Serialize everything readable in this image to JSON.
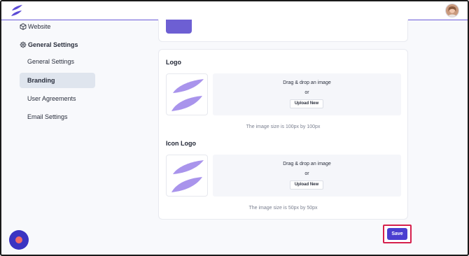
{
  "colors": {
    "accent": "#4a3ed0",
    "logo_purple": "#7b62e0",
    "logo_light": "#b7a8ee",
    "highlight_border": "#d6204d"
  },
  "header": {
    "brand_icon": "leaf-logo-icon",
    "avatar_icon": "user-avatar"
  },
  "sidebar": {
    "website": {
      "label": "Website",
      "icon": "cube-icon"
    },
    "general_settings": {
      "label": "General Settings",
      "icon": "gear-icon"
    },
    "sub_items": [
      {
        "label": "General Settings",
        "active": false
      },
      {
        "label": "Branding",
        "active": true
      },
      {
        "label": "User Agreements",
        "active": false
      },
      {
        "label": "Email Settings",
        "active": false
      }
    ]
  },
  "logo_section": {
    "title": "Logo",
    "drop_text": "Drag & drop an image",
    "or_text": "or",
    "upload_label": "Upload New",
    "size_note": "The image size is 100px by 100px"
  },
  "icon_logo_section": {
    "title": "Icon Logo",
    "drop_text": "Drag & drop an image",
    "or_text": "or",
    "upload_label": "Upload New",
    "size_note": "The image size is 50px by 50px"
  },
  "footer": {
    "save_label": "Save"
  }
}
